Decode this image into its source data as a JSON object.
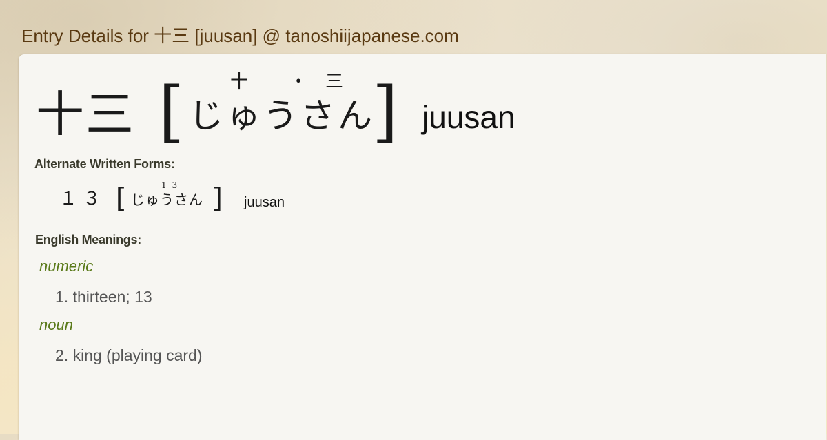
{
  "site_title": "Entry Details for 十三 [juusan] @ tanoshiijapanese.com",
  "entry": {
    "kanji": "十三",
    "reading": "じゅうさん",
    "furigana": {
      "first": "十",
      "dot": "・",
      "second": "三"
    },
    "bracket_open": "[",
    "bracket_close": "]",
    "romaji": "juusan"
  },
  "alternate": {
    "label": "Alternate Written Forms:",
    "kanji": "１３",
    "reading": "じゅうさん",
    "furigana": "1 3",
    "bracket_open": "[",
    "bracket_close": "]",
    "romaji": "juusan"
  },
  "meanings": {
    "label": "English Meanings:",
    "groups": [
      {
        "pos": "numeric",
        "definition": "1. thirteen; 13"
      },
      {
        "pos": "noun",
        "definition": "2. king (playing card)"
      }
    ]
  },
  "colors": {
    "title": "#5a3a12",
    "pos": "#5a7a1a",
    "meaning": "#555555",
    "card": "#f7f6f2"
  }
}
